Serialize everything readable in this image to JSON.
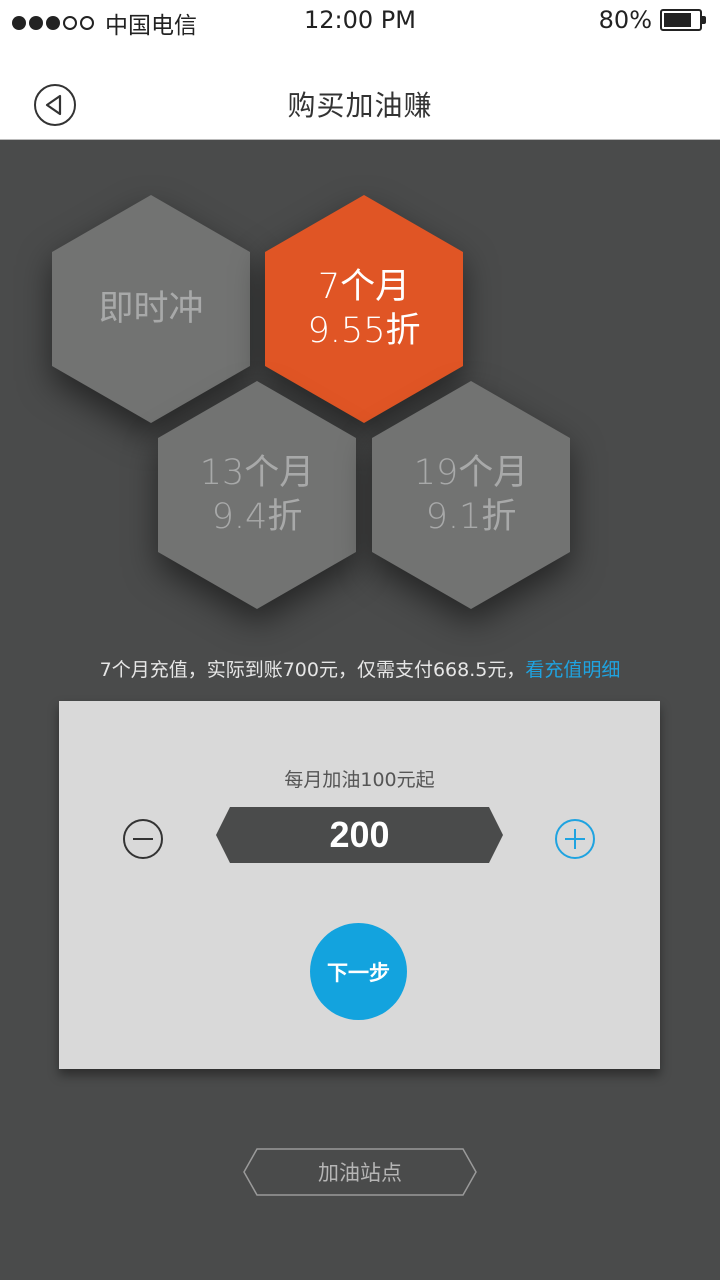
{
  "status_bar": {
    "carrier": "中国电信",
    "time": "12:00 PM",
    "battery_percent": "80%",
    "battery_level": 0.8,
    "signal_bars_filled": 3,
    "signal_bars_total": 5
  },
  "nav": {
    "title": "购买加油赚",
    "back_icon": "back-arrow-icon"
  },
  "plans": [
    {
      "line1": "即时冲",
      "line2": "",
      "selected": false
    },
    {
      "line1": "7个月",
      "line2": "9.55折",
      "selected": true
    },
    {
      "line1": "13个月",
      "line2": "9.4折",
      "selected": false
    },
    {
      "line1": "19个月",
      "line2": "9.1折",
      "selected": false
    }
  ],
  "summary": {
    "text": "7个月充值，实际到账700元，仅需支付668.5元，",
    "link": "看充值明细"
  },
  "card": {
    "hint": "每月加油100元起",
    "amount": "200",
    "next_label": "下一步"
  },
  "footer": {
    "station_label": "加油站点"
  },
  "colors": {
    "background": "#4a4b4b",
    "hex_default": "#727372",
    "hex_selected": "#e05525",
    "accent_blue": "#13a3de",
    "card": "#d9d9d9"
  }
}
